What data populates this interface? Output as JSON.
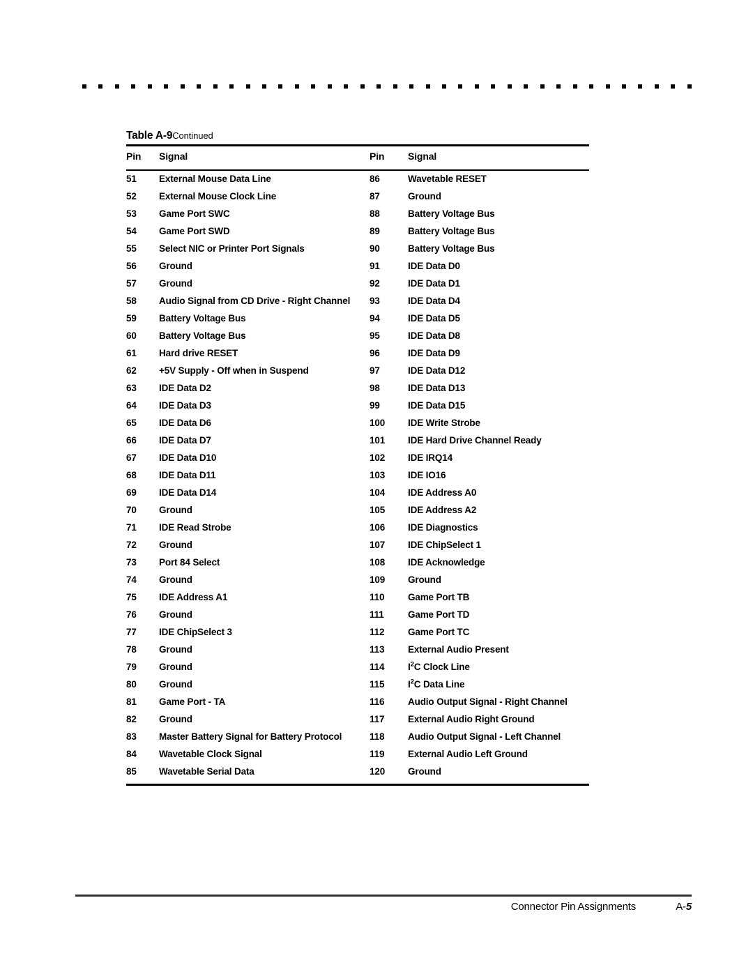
{
  "decor": {
    "dot_rule_count": 38,
    "dot_color": "#000000"
  },
  "table": {
    "caption_strong": "Table A-9",
    "caption_rest": "Continued",
    "headers": {
      "pin_left": "Pin",
      "signal_left": "Signal",
      "pin_right": "Pin",
      "signal_right": "Signal"
    },
    "rows": [
      {
        "pin_left": "51",
        "signal_left": "External Mouse Data Line",
        "pin_right": "86",
        "signal_right": "Wavetable RESET"
      },
      {
        "pin_left": "52",
        "signal_left": "External Mouse Clock Line",
        "pin_right": "87",
        "signal_right": "Ground"
      },
      {
        "pin_left": "53",
        "signal_left": "Game Port SWC",
        "pin_right": "88",
        "signal_right": "Battery Voltage Bus"
      },
      {
        "pin_left": "54",
        "signal_left": "Game Port SWD",
        "pin_right": "89",
        "signal_right": "Battery Voltage Bus"
      },
      {
        "pin_left": "55",
        "signal_left": "Select NIC or Printer Port Signals",
        "pin_right": "90",
        "signal_right": "Battery Voltage Bus"
      },
      {
        "pin_left": "56",
        "signal_left": "Ground",
        "pin_right": "91",
        "signal_right": "IDE Data D0"
      },
      {
        "pin_left": "57",
        "signal_left": "Ground",
        "pin_right": "92",
        "signal_right": "IDE Data D1"
      },
      {
        "pin_left": "58",
        "signal_left": "Audio Signal from CD Drive - Right Channel",
        "pin_right": "93",
        "signal_right": "IDE Data D4"
      },
      {
        "pin_left": "59",
        "signal_left": "Battery Voltage Bus",
        "pin_right": "94",
        "signal_right": "IDE Data D5"
      },
      {
        "pin_left": "60",
        "signal_left": "Battery Voltage Bus",
        "pin_right": "95",
        "signal_right": "IDE Data D8"
      },
      {
        "pin_left": "61",
        "signal_left": "Hard drive RESET",
        "pin_right": "96",
        "signal_right": "IDE Data D9"
      },
      {
        "pin_left": "62",
        "signal_left": "+5V Supply - Off when in Suspend",
        "pin_right": "97",
        "signal_right": "IDE Data D12"
      },
      {
        "pin_left": "63",
        "signal_left": "IDE Data D2",
        "pin_right": "98",
        "signal_right": "IDE Data D13"
      },
      {
        "pin_left": "64",
        "signal_left": "IDE Data D3",
        "pin_right": "99",
        "signal_right": "IDE Data D15"
      },
      {
        "pin_left": "65",
        "signal_left": "IDE Data D6",
        "pin_right": "100",
        "signal_right": "IDE Write Strobe"
      },
      {
        "pin_left": "66",
        "signal_left": "IDE Data D7",
        "pin_right": "101",
        "signal_right": "IDE Hard Drive Channel Ready"
      },
      {
        "pin_left": "67",
        "signal_left": "IDE Data D10",
        "pin_right": "102",
        "signal_right": "IDE IRQ14"
      },
      {
        "pin_left": "68",
        "signal_left": "IDE Data D11",
        "pin_right": "103",
        "signal_right": "IDE IO16"
      },
      {
        "pin_left": "69",
        "signal_left": "IDE Data D14",
        "pin_right": "104",
        "signal_right": "IDE Address A0"
      },
      {
        "pin_left": "70",
        "signal_left": "Ground",
        "pin_right": "105",
        "signal_right": "IDE Address A2"
      },
      {
        "pin_left": "71",
        "signal_left": "IDE Read Strobe",
        "pin_right": "106",
        "signal_right": "IDE Diagnostics"
      },
      {
        "pin_left": "72",
        "signal_left": "Ground",
        "pin_right": "107",
        "signal_right": "IDE ChipSelect 1"
      },
      {
        "pin_left": "73",
        "signal_left": "Port 84 Select",
        "pin_right": "108",
        "signal_right": "IDE Acknowledge"
      },
      {
        "pin_left": "74",
        "signal_left": "Ground",
        "pin_right": "109",
        "signal_right": "Ground"
      },
      {
        "pin_left": "75",
        "signal_left": "IDE Address A1",
        "pin_right": "110",
        "signal_right": "Game Port TB"
      },
      {
        "pin_left": "76",
        "signal_left": "Ground",
        "pin_right": "111",
        "signal_right": "Game Port TD"
      },
      {
        "pin_left": "77",
        "signal_left": "IDE ChipSelect 3",
        "pin_right": "112",
        "signal_right": "Game Port TC"
      },
      {
        "pin_left": "78",
        "signal_left": "Ground",
        "pin_right": "113",
        "signal_right": "External Audio Present"
      },
      {
        "pin_left": "79",
        "signal_left": "Ground",
        "pin_right": "114",
        "signal_right": "I2C Clock Line",
        "signal_right_sup": {
          "before": "I",
          "sup": "2",
          "after": "C Clock Line"
        }
      },
      {
        "pin_left": "80",
        "signal_left": "Ground",
        "pin_right": "115",
        "signal_right": "I2C Data Line",
        "signal_right_sup": {
          "before": "I",
          "sup": "2",
          "after": "C Data Line"
        }
      },
      {
        "pin_left": "81",
        "signal_left": "Game Port - TA",
        "pin_right": "116",
        "signal_right": "Audio Output Signal - Right Channel"
      },
      {
        "pin_left": "82",
        "signal_left": "Ground",
        "pin_right": "117",
        "signal_right": "External Audio Right Ground"
      },
      {
        "pin_left": "83",
        "signal_left": "Master Battery Signal for Battery Protocol",
        "pin_right": "118",
        "signal_right": "Audio Output Signal - Left Channel"
      },
      {
        "pin_left": "84",
        "signal_left": "Wavetable Clock Signal",
        "pin_right": "119",
        "signal_right": "External Audio Left Ground"
      },
      {
        "pin_left": "85",
        "signal_left": "Wavetable Serial Data",
        "pin_right": "120",
        "signal_right": "Ground"
      }
    ]
  },
  "footer": {
    "section_title": "Connector Pin Assignments",
    "page_prefix": "A-",
    "page_number": "5"
  }
}
